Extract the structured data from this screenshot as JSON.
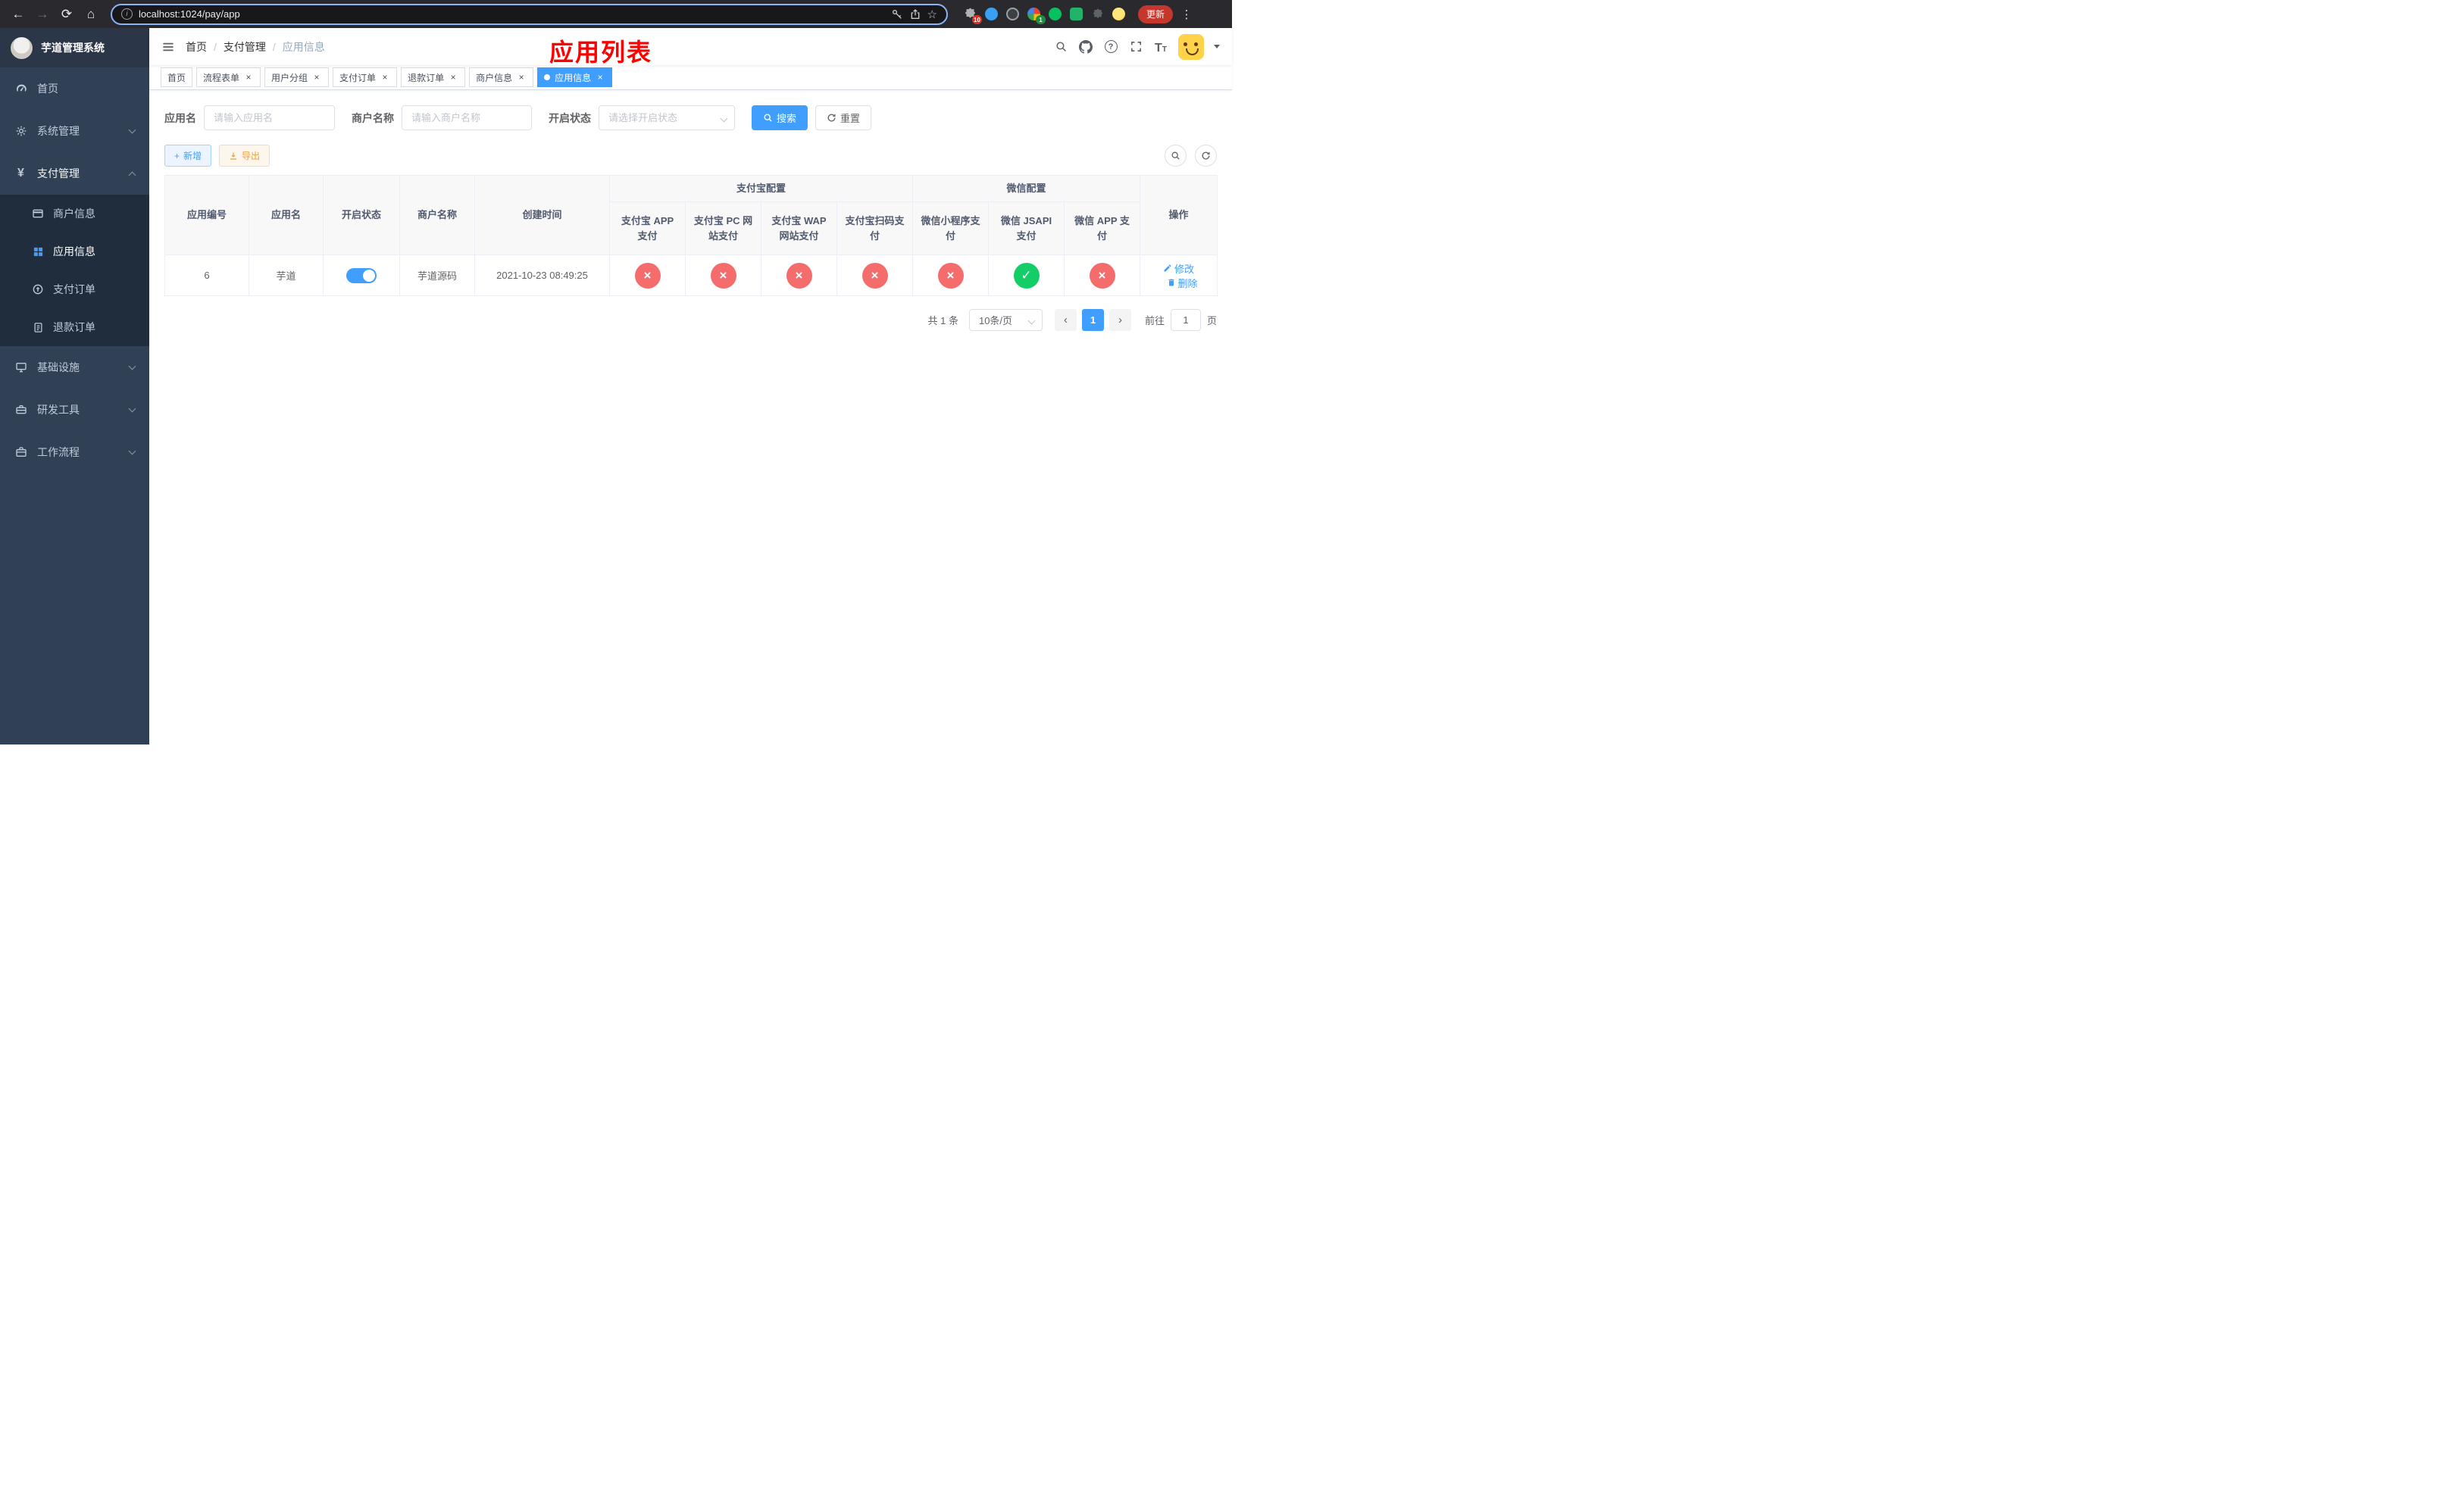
{
  "colors": {
    "accent": "#409eff",
    "danger": "#f56c6c",
    "success": "#13ce66",
    "warning": "#e6a23c",
    "sidebar-bg": "#304156",
    "submenu-bg": "#1f2d3d",
    "annotation": "#ff0000"
  },
  "icons": {
    "back": "←",
    "forward": "→",
    "reload": "⟳",
    "home": "⌂",
    "info": "i",
    "star": "☆",
    "dots": "⋮",
    "close": "×",
    "check": "✓",
    "cross": "×",
    "prev": "‹",
    "next": "›",
    "slash": "/",
    "question": "?",
    "plus": "+",
    "font_large": "T",
    "font_small": "T"
  },
  "browser": {
    "url": "localhost:1024/pay/app",
    "update_label": "更新",
    "puzzle_badge": "10",
    "translate_badge": "1"
  },
  "sidebar": {
    "title": "芋道管理系统",
    "items": [
      {
        "label": "首页"
      },
      {
        "label": "系统管理"
      },
      {
        "label": "支付管理",
        "children": [
          {
            "label": "商户信息"
          },
          {
            "label": "应用信息",
            "active": true
          },
          {
            "label": "支付订单"
          },
          {
            "label": "退款订单"
          }
        ]
      },
      {
        "label": "基础设施"
      },
      {
        "label": "研发工具"
      },
      {
        "label": "工作流程"
      }
    ]
  },
  "header": {
    "breadcrumb": [
      "首页",
      "支付管理",
      "应用信息"
    ],
    "annotation": "应用列表"
  },
  "tabs": [
    {
      "label": "首页",
      "closable": false
    },
    {
      "label": "流程表单",
      "closable": true
    },
    {
      "label": "用户分组",
      "closable": true
    },
    {
      "label": "支付订单",
      "closable": true
    },
    {
      "label": "退款订单",
      "closable": true
    },
    {
      "label": "商户信息",
      "closable": true
    },
    {
      "label": "应用信息",
      "closable": true,
      "active": true
    }
  ],
  "filters": {
    "app_name_label": "应用名",
    "app_name_placeholder": "请输入应用名",
    "merchant_label": "商户名称",
    "merchant_placeholder": "请输入商户名称",
    "status_label": "开启状态",
    "status_placeholder": "请选择开启状态",
    "search_button": "搜索",
    "reset_button": "重置"
  },
  "toolbar": {
    "add_button": "新增",
    "export_button": "导出"
  },
  "table": {
    "group_alipay": "支付宝配置",
    "group_wechat": "微信配置",
    "col_id": "应用编号",
    "col_name": "应用名",
    "col_status": "开启状态",
    "col_merchant": "商户名称",
    "col_created": "创建时间",
    "col_op": "操作",
    "alipay_cols": [
      "支付宝 APP 支付",
      "支付宝 PC 网站支付",
      "支付宝 WAP 网站支付",
      "支付宝扫码支付"
    ],
    "wechat_cols": [
      "微信小程序支付",
      "微信 JSAPI 支付",
      "微信 APP 支付"
    ],
    "rows": [
      {
        "id": "6",
        "name": "芋道",
        "enabled": true,
        "merchant": "芋道源码",
        "created": "2021-10-23 08:49:25",
        "channels": [
          false,
          false,
          false,
          false,
          false,
          true,
          false
        ],
        "edit": "修改",
        "delete": "删除"
      }
    ]
  },
  "pagination": {
    "total": "共 1 条",
    "page_size": "10条/页",
    "page": "1",
    "goto": "前往",
    "goto_value": "1",
    "unit": "页"
  }
}
